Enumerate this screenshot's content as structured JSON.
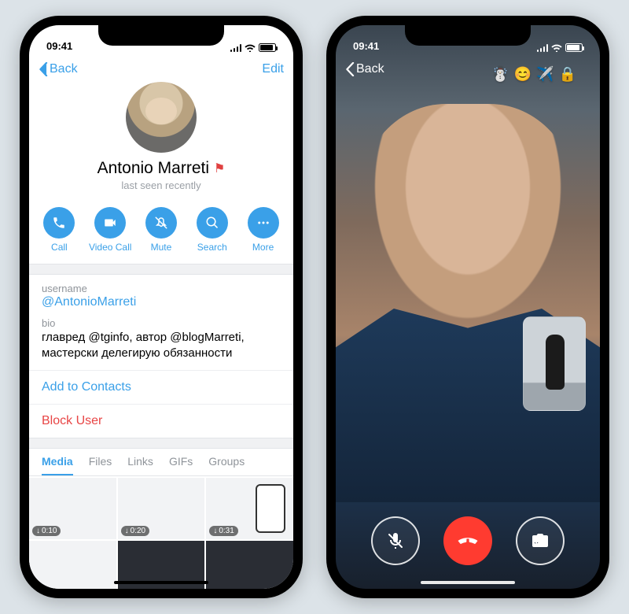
{
  "left": {
    "status": {
      "time": "09:41"
    },
    "nav": {
      "back": "Back",
      "edit": "Edit"
    },
    "profile": {
      "name": "Antonio Marreti",
      "status": "last seen recently"
    },
    "actions": {
      "call": "Call",
      "video": "Video Call",
      "mute": "Mute",
      "search": "Search",
      "more": "More"
    },
    "info": {
      "username_label": "username",
      "username": "@AntonioMarreti",
      "bio_label": "bio",
      "bio": "главред @tginfo, автор @blogMarreti, мастерски делегирую обязанности"
    },
    "links": {
      "add": "Add to Contacts",
      "block": "Block User"
    },
    "tabs": {
      "media": "Media",
      "files": "Files",
      "links": "Links",
      "gifs": "GIFs",
      "groups": "Groups"
    },
    "media_durations": [
      "0:10",
      "0:20",
      "0:31"
    ]
  },
  "right": {
    "status": {
      "time": "09:41"
    },
    "nav": {
      "back": "Back"
    },
    "emoji": [
      "☃️",
      "😊",
      "✈️",
      "🔒"
    ]
  },
  "colors": {
    "accent": "#3aa0e8",
    "danger": "#e84545",
    "end_call": "#ff3b30"
  }
}
